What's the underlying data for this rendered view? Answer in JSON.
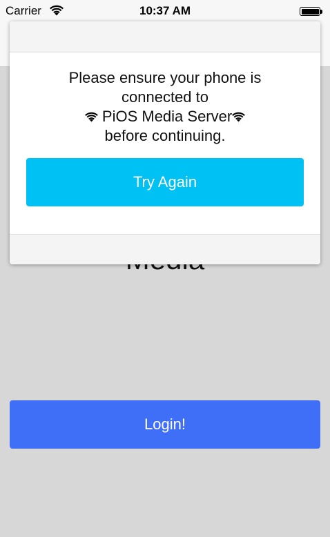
{
  "status_bar": {
    "carrier": "Carrier",
    "time": "10:37 AM",
    "icons": [
      "wifi-icon",
      "battery-icon"
    ]
  },
  "background": {
    "title": "Media",
    "login_label": "Login!",
    "login_color": "#3f6ef7",
    "background_color": "#d7d7d7"
  },
  "modal": {
    "message_line1": "Please ensure your phone is",
    "message_line2": "connected to",
    "network_name": "PiOS Media Server",
    "message_line4": "before continuing.",
    "try_again_label": "Try Again",
    "try_again_color": "#00c1f3",
    "network_icon": "wifi-icon"
  }
}
